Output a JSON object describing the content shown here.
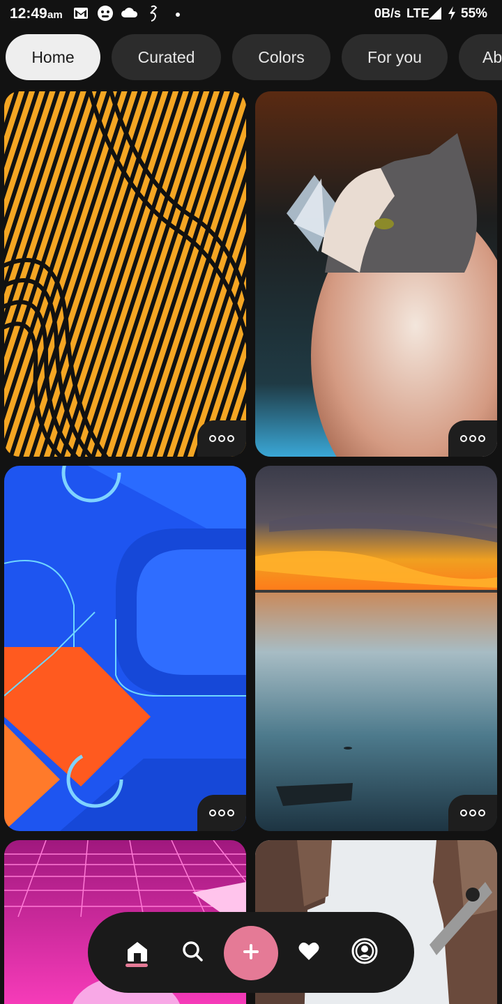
{
  "status_bar": {
    "time": "12:49",
    "ampm": "am",
    "data_rate": "0B/s",
    "network": "LTE",
    "battery": "55%",
    "icons": [
      "gmail-icon",
      "emoji-icon",
      "cloud-icon",
      "clipboard-icon",
      "dot-icon",
      "signal-icon",
      "charging-icon"
    ]
  },
  "chips": [
    {
      "label": "Home",
      "active": true
    },
    {
      "label": "Curated",
      "active": false
    },
    {
      "label": "Colors",
      "active": false
    },
    {
      "label": "For you",
      "active": false
    },
    {
      "label": "Ab",
      "active": false
    }
  ],
  "wallpapers": [
    {
      "name": "orange-black-waves"
    },
    {
      "name": "cat-with-butterfly"
    },
    {
      "name": "blue-orange-geometric"
    },
    {
      "name": "sunset-lake"
    },
    {
      "name": "pink-synthwave-grid"
    },
    {
      "name": "alley-buildings"
    }
  ],
  "bottom_nav": {
    "items": [
      "home-icon",
      "search-icon",
      "add-icon",
      "heart-icon",
      "profile-icon"
    ],
    "accent": "#e57a96"
  }
}
